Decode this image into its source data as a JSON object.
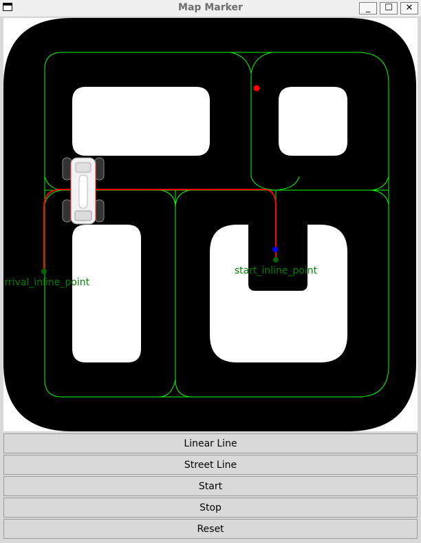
{
  "window": {
    "title": "Map Marker",
    "minimize_glyph": "_",
    "maximize_glyph": "☐",
    "close_glyph": "✕"
  },
  "map": {
    "start_label": "start_inline_point",
    "arrival_label": "arrival_inline_point",
    "colors": {
      "track": "#000000",
      "lane": "#00ff00",
      "route": "#ff0000",
      "inline_point": "#006400",
      "marker_red": "#ff0000",
      "marker_blue": "#0000ff"
    }
  },
  "buttons": {
    "linear_line": "Linear Line",
    "street_line": "Street Line",
    "start": "Start",
    "stop": "Stop",
    "reset": "Reset"
  }
}
